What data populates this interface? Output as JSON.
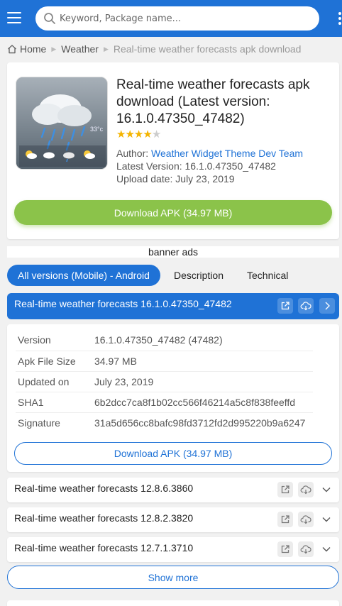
{
  "header": {
    "search_placeholder": "Keyword, Package name...",
    "menu_icon": "hamburger-menu-icon",
    "more_icon": "vertical-dots-icon",
    "colors": {
      "brand": "#1f72d6",
      "accent_green": "#8bc34a"
    }
  },
  "breadcrumb": {
    "items": [
      "Home",
      "Weather",
      "Real-time weather forecasts apk download"
    ]
  },
  "app": {
    "title": "Real-time weather forecasts apk download (Latest version: 16.1.0.47350_47482)",
    "rating_stars": 4.5,
    "author_label": "Author:",
    "author_name": "Weather Widget Theme Dev Team",
    "latest_version": "Latest Version: 16.1.0.47350_47482",
    "upload_date": "Upload date: July 23, 2019",
    "icon_temp": "33°c",
    "download_label": "Download APK (34.97 MB)"
  },
  "banner": {
    "text": "banner ads"
  },
  "tabs": [
    {
      "label": "All versions (Mobile) - Android",
      "active": true
    },
    {
      "label": "Description",
      "active": false
    },
    {
      "label": "Technical",
      "active": false
    }
  ],
  "current_version": {
    "title": "Real-time weather forecasts 16.1.0.47350_47482",
    "details": [
      {
        "key": "Version",
        "value": "16.1.0.47350_47482 (47482)"
      },
      {
        "key": "Apk File Size",
        "value": "34.97 MB"
      },
      {
        "key": "Updated on",
        "value": "July 23, 2019"
      },
      {
        "key": "SHA1",
        "value": "6b2dcc7ca8f1b02cc566f46214a5c8f838feeffd"
      },
      {
        "key": "Signature",
        "value": "31a5d656cc8bafc98fd3712fd2d995220b9a6247"
      }
    ],
    "download_label": "Download APK (34.97 MB)"
  },
  "other_versions": [
    {
      "title": "Real-time weather forecasts 12.8.6.3860"
    },
    {
      "title": "Real-time weather forecasts 12.8.2.3820"
    },
    {
      "title": "Real-time weather forecasts 12.7.1.3710"
    }
  ],
  "show_more_label": "Show more"
}
